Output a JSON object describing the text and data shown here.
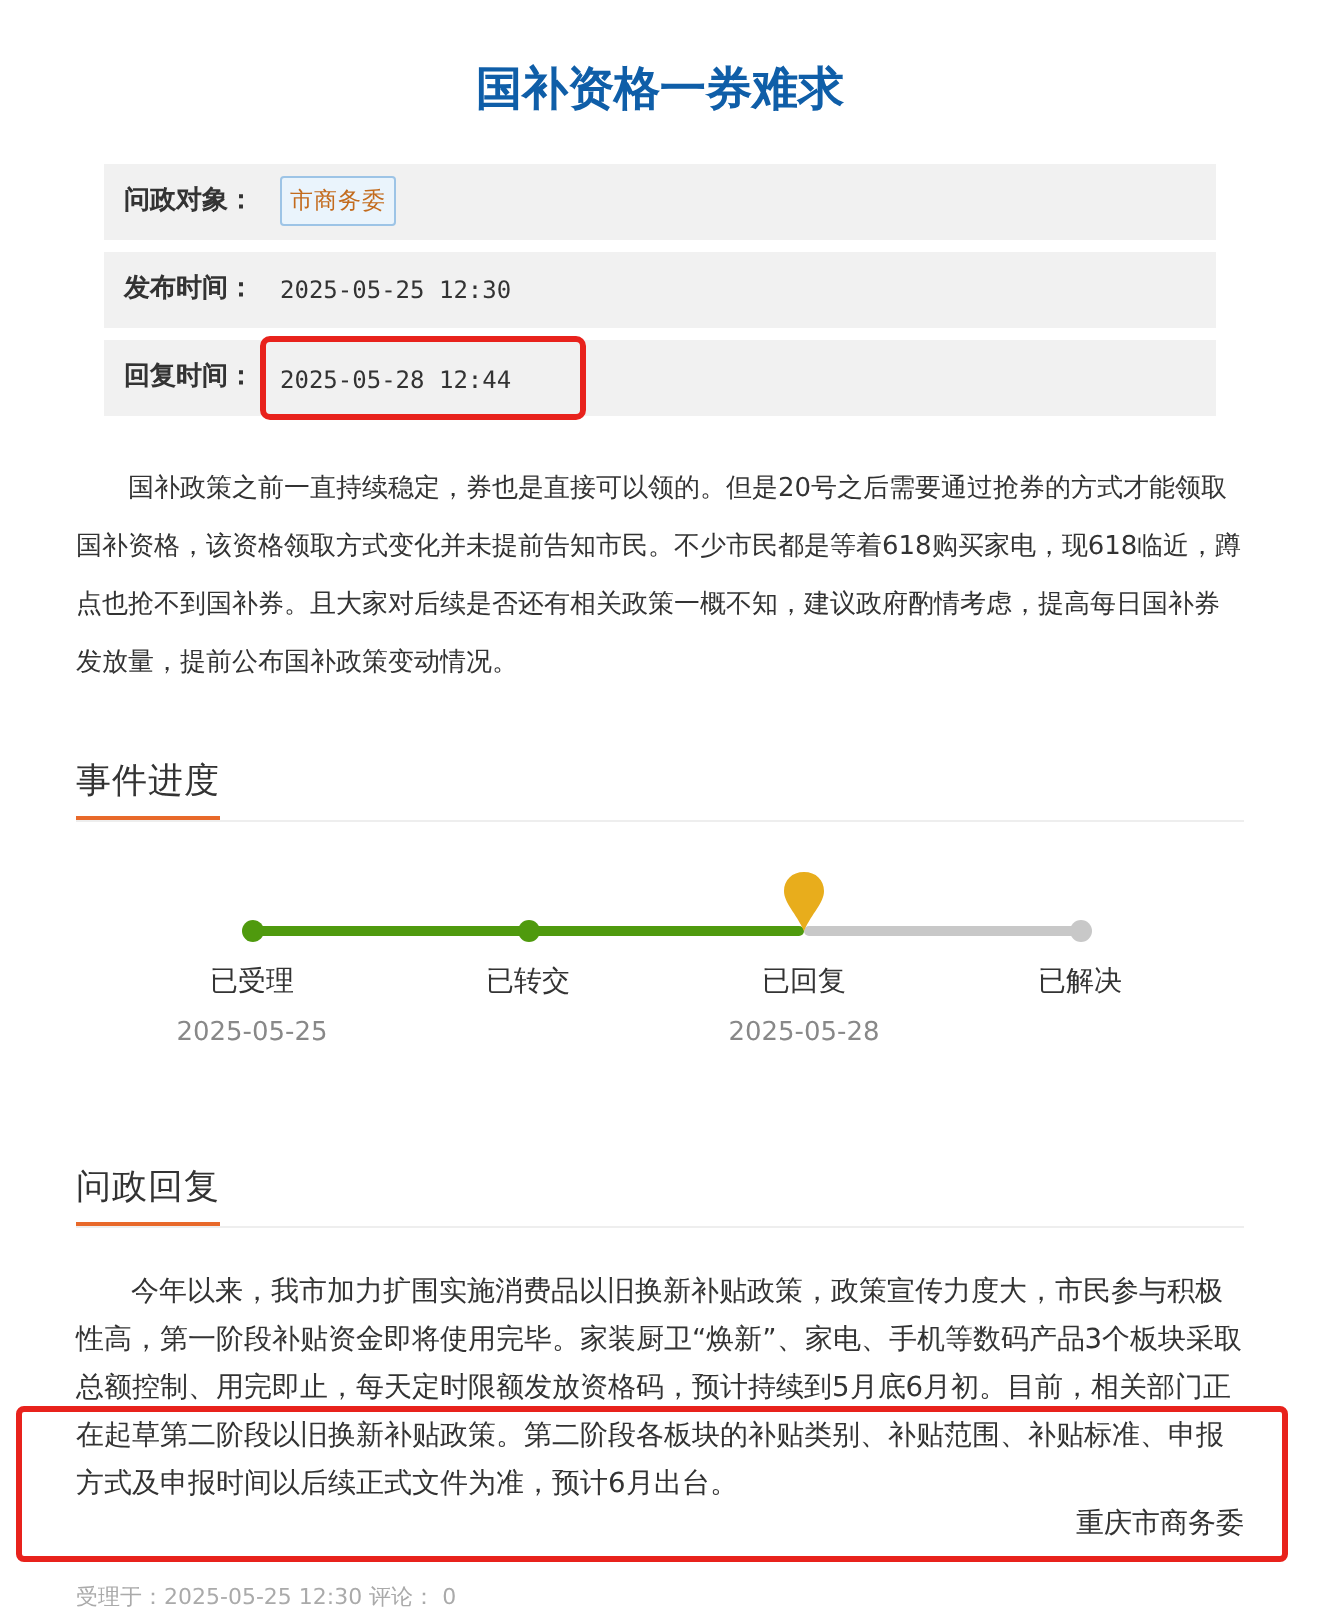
{
  "title": "国补资格一券难求",
  "info": [
    {
      "label": "问政对象：",
      "value": "市商务委",
      "kind": "tag",
      "highlighted": false
    },
    {
      "label": "发布时间：",
      "value": "2025-05-25 12:30",
      "kind": "text",
      "highlighted": false
    },
    {
      "label": "回复时间：",
      "value": "2025-05-28 12:44",
      "kind": "text",
      "highlighted": true
    }
  ],
  "question": "国补政策之前一直持续稳定，券也是直接可以领的。但是20号之后需要通过抢券的方式才能领取国补资格，该资格领取方式变化并未提前告知市民。不少市民都是等着618购买家电，现618临近，蹲点也抢不到国补券。且大家对后续是否还有相关政策一概不知，建议政府酌情考虑，提高每日国补券发放量，提前公布国补政策变动情况。",
  "progress": {
    "heading": "事件进度",
    "steps": [
      {
        "label": "已受理",
        "date": "2025-05-25",
        "reached": true,
        "current": false
      },
      {
        "label": "已转交",
        "reached": true,
        "current": false
      },
      {
        "label": "已回复",
        "date": "2025-05-28",
        "reached": true,
        "current": true
      },
      {
        "label": "已解决",
        "reached": false,
        "current": false
      }
    ]
  },
  "reply": {
    "heading": "问政回复",
    "body": "今年以来，我市加力扩围实施消费品以旧换新补贴政策，政策宣传力度大，市民参与积极性高，第一阶段补贴资金即将使用完毕。家装厨卫“焕新”、家电、手机等数码产品3个板块采取总额控制、用完即止，每天定时限额发放资格码，预计持续到5月底6月初。目前，相关部门正在起草第二阶段以旧换新补贴政策。第二阶段各板块的补贴类别、补贴范围、补贴标准、申报方式及申报时间以后续正式文件为准，预计6月出台。",
    "signature": "重庆市商务委",
    "highlight_tail": true
  },
  "footer": "受理于：2025-05-25 12:30 评论： 0"
}
